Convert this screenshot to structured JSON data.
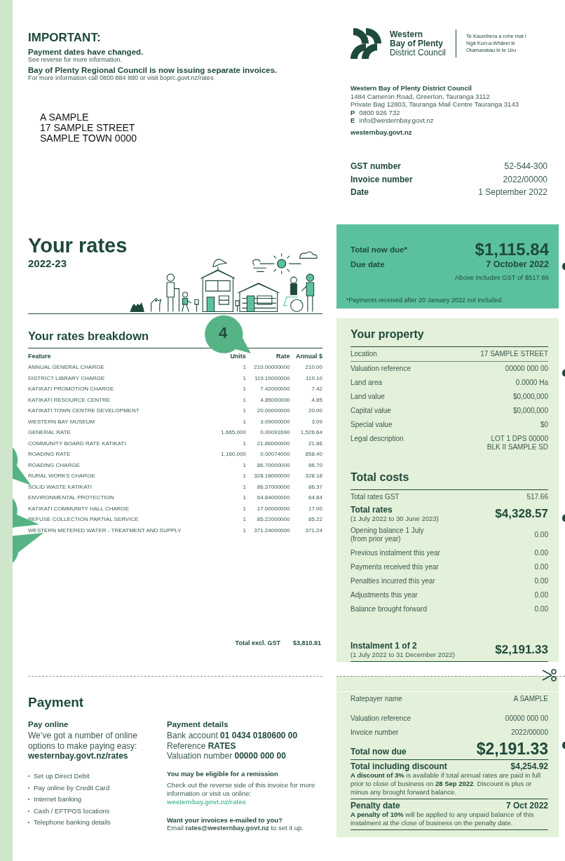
{
  "notice": {
    "title": "IMPORTANT:",
    "items": [
      {
        "heading": "Payment dates have changed.",
        "text": "See reverse for more information."
      },
      {
        "heading": "Bay of Plenty Regional Council is now issuing separate invoices.",
        "text": "For more information call 0800 884 880 or visit boprc.govt.nz/rates"
      }
    ]
  },
  "address": [
    "A SAMPLE",
    "17 SAMPLE STREET",
    "SAMPLE TOWN 0000"
  ],
  "logo": {
    "lines": [
      "Western",
      "Bay of Plenty",
      "District Council"
    ],
    "motto": [
      "Te Kaunihera a rohe mai i",
      "Ngā Kuri-a-Whārei ki",
      "Otamarakau ki te Uru"
    ]
  },
  "council": {
    "name": "Western Bay of Plenty District Council",
    "lines": [
      "1484 Cameron Road, Greerton, Tauranga 3112",
      "Private Bag 12803, Tauranga Mail Centre Tauranga 3143"
    ],
    "contacts": [
      {
        "label": "P",
        "value": "0800 926 732"
      },
      {
        "label": "E",
        "value": "info@westernbay.govt.nz"
      }
    ],
    "website": "westernbay.govt.nz"
  },
  "invoice_info": [
    {
      "label": "GST number",
      "value": "52-544-300"
    },
    {
      "label": "Invoice number",
      "value": "2022/00000"
    },
    {
      "label": "Date",
      "value": "1 September 2022"
    }
  ],
  "rates": {
    "title": "Your rates",
    "year": "2022-23"
  },
  "breakdown": {
    "title": "Your rates breakdown",
    "callout": "4",
    "columns": [
      "Feature",
      "Units",
      "Rate",
      "Annual $"
    ],
    "rows": [
      [
        "ANNUAL GENERAL CHARGE",
        "1",
        "210.00000000",
        "210.00"
      ],
      [
        "DISTRICT LIBRARY CHARGE",
        "1",
        "119.10000000",
        "119.10"
      ],
      [
        "KATIKATI PROMOTION CHARGE",
        "1",
        "7.42000000",
        "7.42"
      ],
      [
        "KATIKATI RESOURCE CENTRE",
        "1",
        "4.85000000",
        "4.85"
      ],
      [
        "KATIKATI TOWN CENTRE DEVELOPMENT",
        "1",
        "20.00000000",
        "20.00"
      ],
      [
        "WESTERN BAY MUSEUM",
        "1",
        "3.09000000",
        "3.09"
      ],
      [
        "GENERAL RATE",
        "1,665,000",
        "0.00091690",
        "1,526.64"
      ],
      [
        "COMMUNITY BOARD RATE KATIKATI",
        "1",
        "21.86000000",
        "21.86"
      ],
      [
        "ROADING RATE",
        "1,160,000",
        "0.00074000",
        "858.40"
      ],
      [
        "ROADING CHARGE",
        "1",
        "86.70000000",
        "86.70"
      ],
      [
        "RURAL WORKS CHARGE",
        "1",
        "328.18000000",
        "328.18"
      ],
      [
        "SOLID WASTE KATIKATI",
        "1",
        "86.37000000",
        "86.37"
      ],
      [
        "ENVIRONMENTAL PROTECTION",
        "1",
        "64.84000000",
        "64.84"
      ],
      [
        "KATIKATI COMMUNITY HALL CHARGE",
        "1",
        "17.00000000",
        "17.00"
      ],
      [
        "REFUSE COLLECTION PARTIAL SERVICE",
        "1",
        "85.22000000",
        "85.22"
      ],
      [
        "WESTERN METERED WATER - TREATMENT AND SUPPLY",
        "1",
        "371.24000000",
        "371.24"
      ]
    ],
    "total_label": "Total excl. GST",
    "total_value": "$3,810.91"
  },
  "due_box": {
    "total_label": "Total now due*",
    "total_value": "$1,115.84",
    "date_label": "Due date",
    "date_value": "7 October 2022",
    "gst_note": "Above includes GST of $517.66",
    "footnote": "*Payments received after 20 January 2022 not included."
  },
  "property": {
    "title": "Your property",
    "rows": [
      {
        "label": "Location",
        "value": "17 SAMPLE STREET"
      },
      {
        "label": "Valuation reference",
        "value": "00000 000 00"
      },
      {
        "label": "Land area",
        "value": "0.0000 Ha"
      },
      {
        "label": "Land value",
        "value": "$0,000,000"
      },
      {
        "label": "Capital value",
        "value": "$0,000,000"
      },
      {
        "label": "Special value",
        "value": "$0"
      },
      {
        "label": "Legal description",
        "value": "LOT 1 DPS 00000\nBLK II SAMPLE SD"
      }
    ]
  },
  "total_costs": {
    "title": "Total costs",
    "gst_label": "Total rates GST",
    "gst_value": "517.66",
    "rates_label": "Total rates",
    "rates_period": "(1 July 2022 to 30 June 2023)",
    "rates_value": "$4,328.57",
    "rows": [
      {
        "label": "Opening balance 1 July\n(from prior year)",
        "value": "0.00"
      },
      {
        "label": "Previous instalment this year",
        "value": "0.00"
      },
      {
        "label": "Payments received this year",
        "value": "0.00"
      },
      {
        "label": "Penalties incurred this year",
        "value": "0.00"
      },
      {
        "label": "Adjustments this year",
        "value": "0.00"
      },
      {
        "label": "Balance brought forward",
        "value": "0.00"
      }
    ],
    "instalment_label": "Instalment 1 of 2",
    "instalment_period": "(1 July 2022 to 31 December 2022)",
    "instalment_value": "$2,191.33"
  },
  "payment": {
    "title": "Payment",
    "online_title": "Pay online",
    "online_text": "We’ve got a number of online options to make paying easy:",
    "online_link": "westernbay.govt.nz/rates",
    "options": [
      "Set up Direct Debit",
      "Pay online by Credit Card",
      "Internet banking",
      "Cash / EFTPOS locations",
      "Telephone banking details"
    ],
    "details_title": "Payment details",
    "details": [
      "Bank account **01 0434 0180600 00**",
      "Reference **RATES**",
      "Valuation number **00000 000 00**"
    ],
    "remission_title": "You may be eligible for a remission",
    "remission_text": "Check out the reverse side of this invoice for more information or visit us online:",
    "remission_link": "westernbay.govt.nz/rates",
    "email_title": "Want your invoices e-mailed to you?",
    "email_text": "Email **rates@westernbay.govt.nz** to set it up."
  },
  "slip": {
    "rows": [
      {
        "label": "Ratepayer name",
        "value": "A SAMPLE"
      },
      {
        "label": "Valuation reference",
        "value": "00000 000 00"
      },
      {
        "label": "Invoice number",
        "value": "2022/00000"
      }
    ],
    "due_label": "Total now due",
    "due_value": "$2,191.33",
    "discount_label": "Total including discount",
    "discount_value": "$4,254.92",
    "discount_text": "**A discount of 3%** is available if total annual rates are paid in full prior to close of business on **28 Sep 2022**. Discount is plus or minus any brought forward balance.",
    "penalty_label": "Penalty date",
    "penalty_value": "7 Oct 2022",
    "penalty_text": "**A penalty of 10%** will be applied to any unpaid balance of this instalment at the close of business on the penalty date."
  }
}
